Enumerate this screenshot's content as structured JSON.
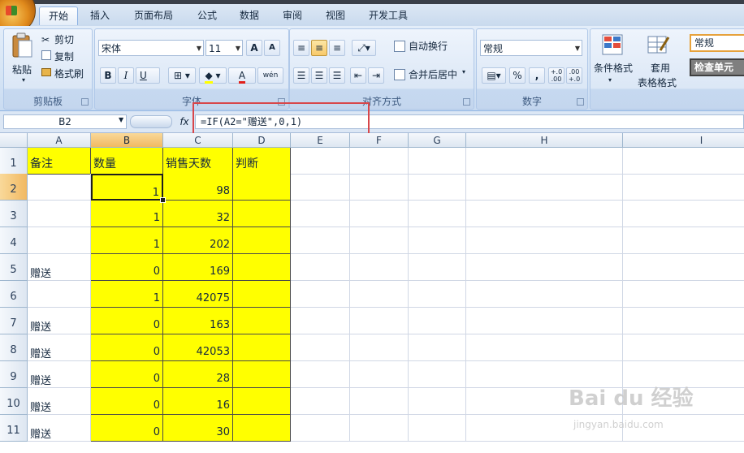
{
  "ribbon": {
    "tabs": [
      "开始",
      "插入",
      "页面布局",
      "公式",
      "数据",
      "审阅",
      "视图",
      "开发工具"
    ],
    "active_tab": "开始",
    "clipboard": {
      "paste": "粘贴",
      "cut": "剪切",
      "copy": "复制",
      "format_painter": "格式刷",
      "label": "剪贴板"
    },
    "font": {
      "name": "宋体",
      "size": "11",
      "label": "字体",
      "bold": "B",
      "italic": "I",
      "underline": "U",
      "grow": "A",
      "shrink": "A",
      "fontcolor": "A",
      "phonetic": "wén"
    },
    "alignment": {
      "wrap": "自动换行",
      "merge": "合并后居中",
      "label": "对齐方式"
    },
    "number": {
      "format": "常规",
      "percent": "%",
      "comma": ",",
      "label": "数字",
      "inc": "+.0 .00",
      "dec": ".00 +.0"
    },
    "styles": {
      "conditional": "条件格式",
      "table_a": "套用",
      "table_b": "表格格式",
      "style_name": "常规",
      "check_cell": "检查单元"
    }
  },
  "formula_bar": {
    "name_box": "B2",
    "fx": "fx",
    "formula": "=IF(A2=\"赠送\",0,1)"
  },
  "grid": {
    "columns": [
      "A",
      "B",
      "C",
      "D",
      "E",
      "F",
      "G",
      "H",
      "I"
    ],
    "selected_column": "B",
    "rows": [
      "1",
      "2",
      "3",
      "4",
      "5",
      "6",
      "7",
      "8",
      "9",
      "10",
      "11"
    ],
    "selected_row": "2",
    "header": {
      "a": "备注",
      "b": "数量",
      "c": "销售天数",
      "d": "判断"
    },
    "data": [
      {
        "a": "",
        "b": "1",
        "c": "98"
      },
      {
        "a": "",
        "b": "1",
        "c": "32"
      },
      {
        "a": "",
        "b": "1",
        "c": "202"
      },
      {
        "a": "赠送",
        "b": "0",
        "c": "169"
      },
      {
        "a": "",
        "b": "1",
        "c": "42075"
      },
      {
        "a": "赠送",
        "b": "0",
        "c": "163"
      },
      {
        "a": "赠送",
        "b": "0",
        "c": "42053"
      },
      {
        "a": "赠送",
        "b": "0",
        "c": "28"
      },
      {
        "a": "赠送",
        "b": "0",
        "c": "16"
      },
      {
        "a": "赠送",
        "b": "0",
        "c": "30"
      }
    ]
  },
  "watermark": {
    "brand": "Bai du 经验",
    "url": "jingyan.baidu.com"
  },
  "colors": {
    "highlight": "#ffff00",
    "annotation": "#d8464a",
    "ribbon": "#dce7f5"
  }
}
